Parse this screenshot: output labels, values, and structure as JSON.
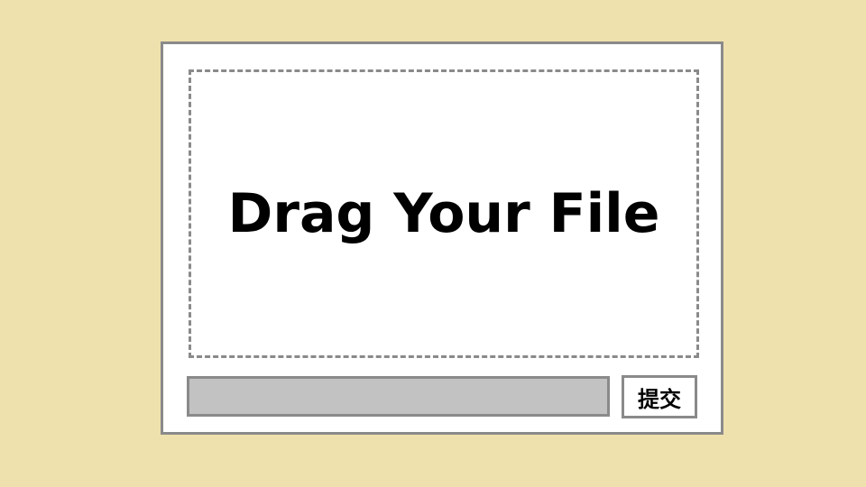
{
  "upload_panel": {
    "drop_zone": {
      "text": "Drag Your File"
    },
    "file_field": {
      "value": "",
      "placeholder": ""
    },
    "submit_button": {
      "label": "提交"
    }
  },
  "colors": {
    "page_background": "#efe1ad",
    "panel_background": "#ffffff",
    "border": "#8a8a8a",
    "input_background": "#c2c2c2",
    "text": "#000000"
  }
}
